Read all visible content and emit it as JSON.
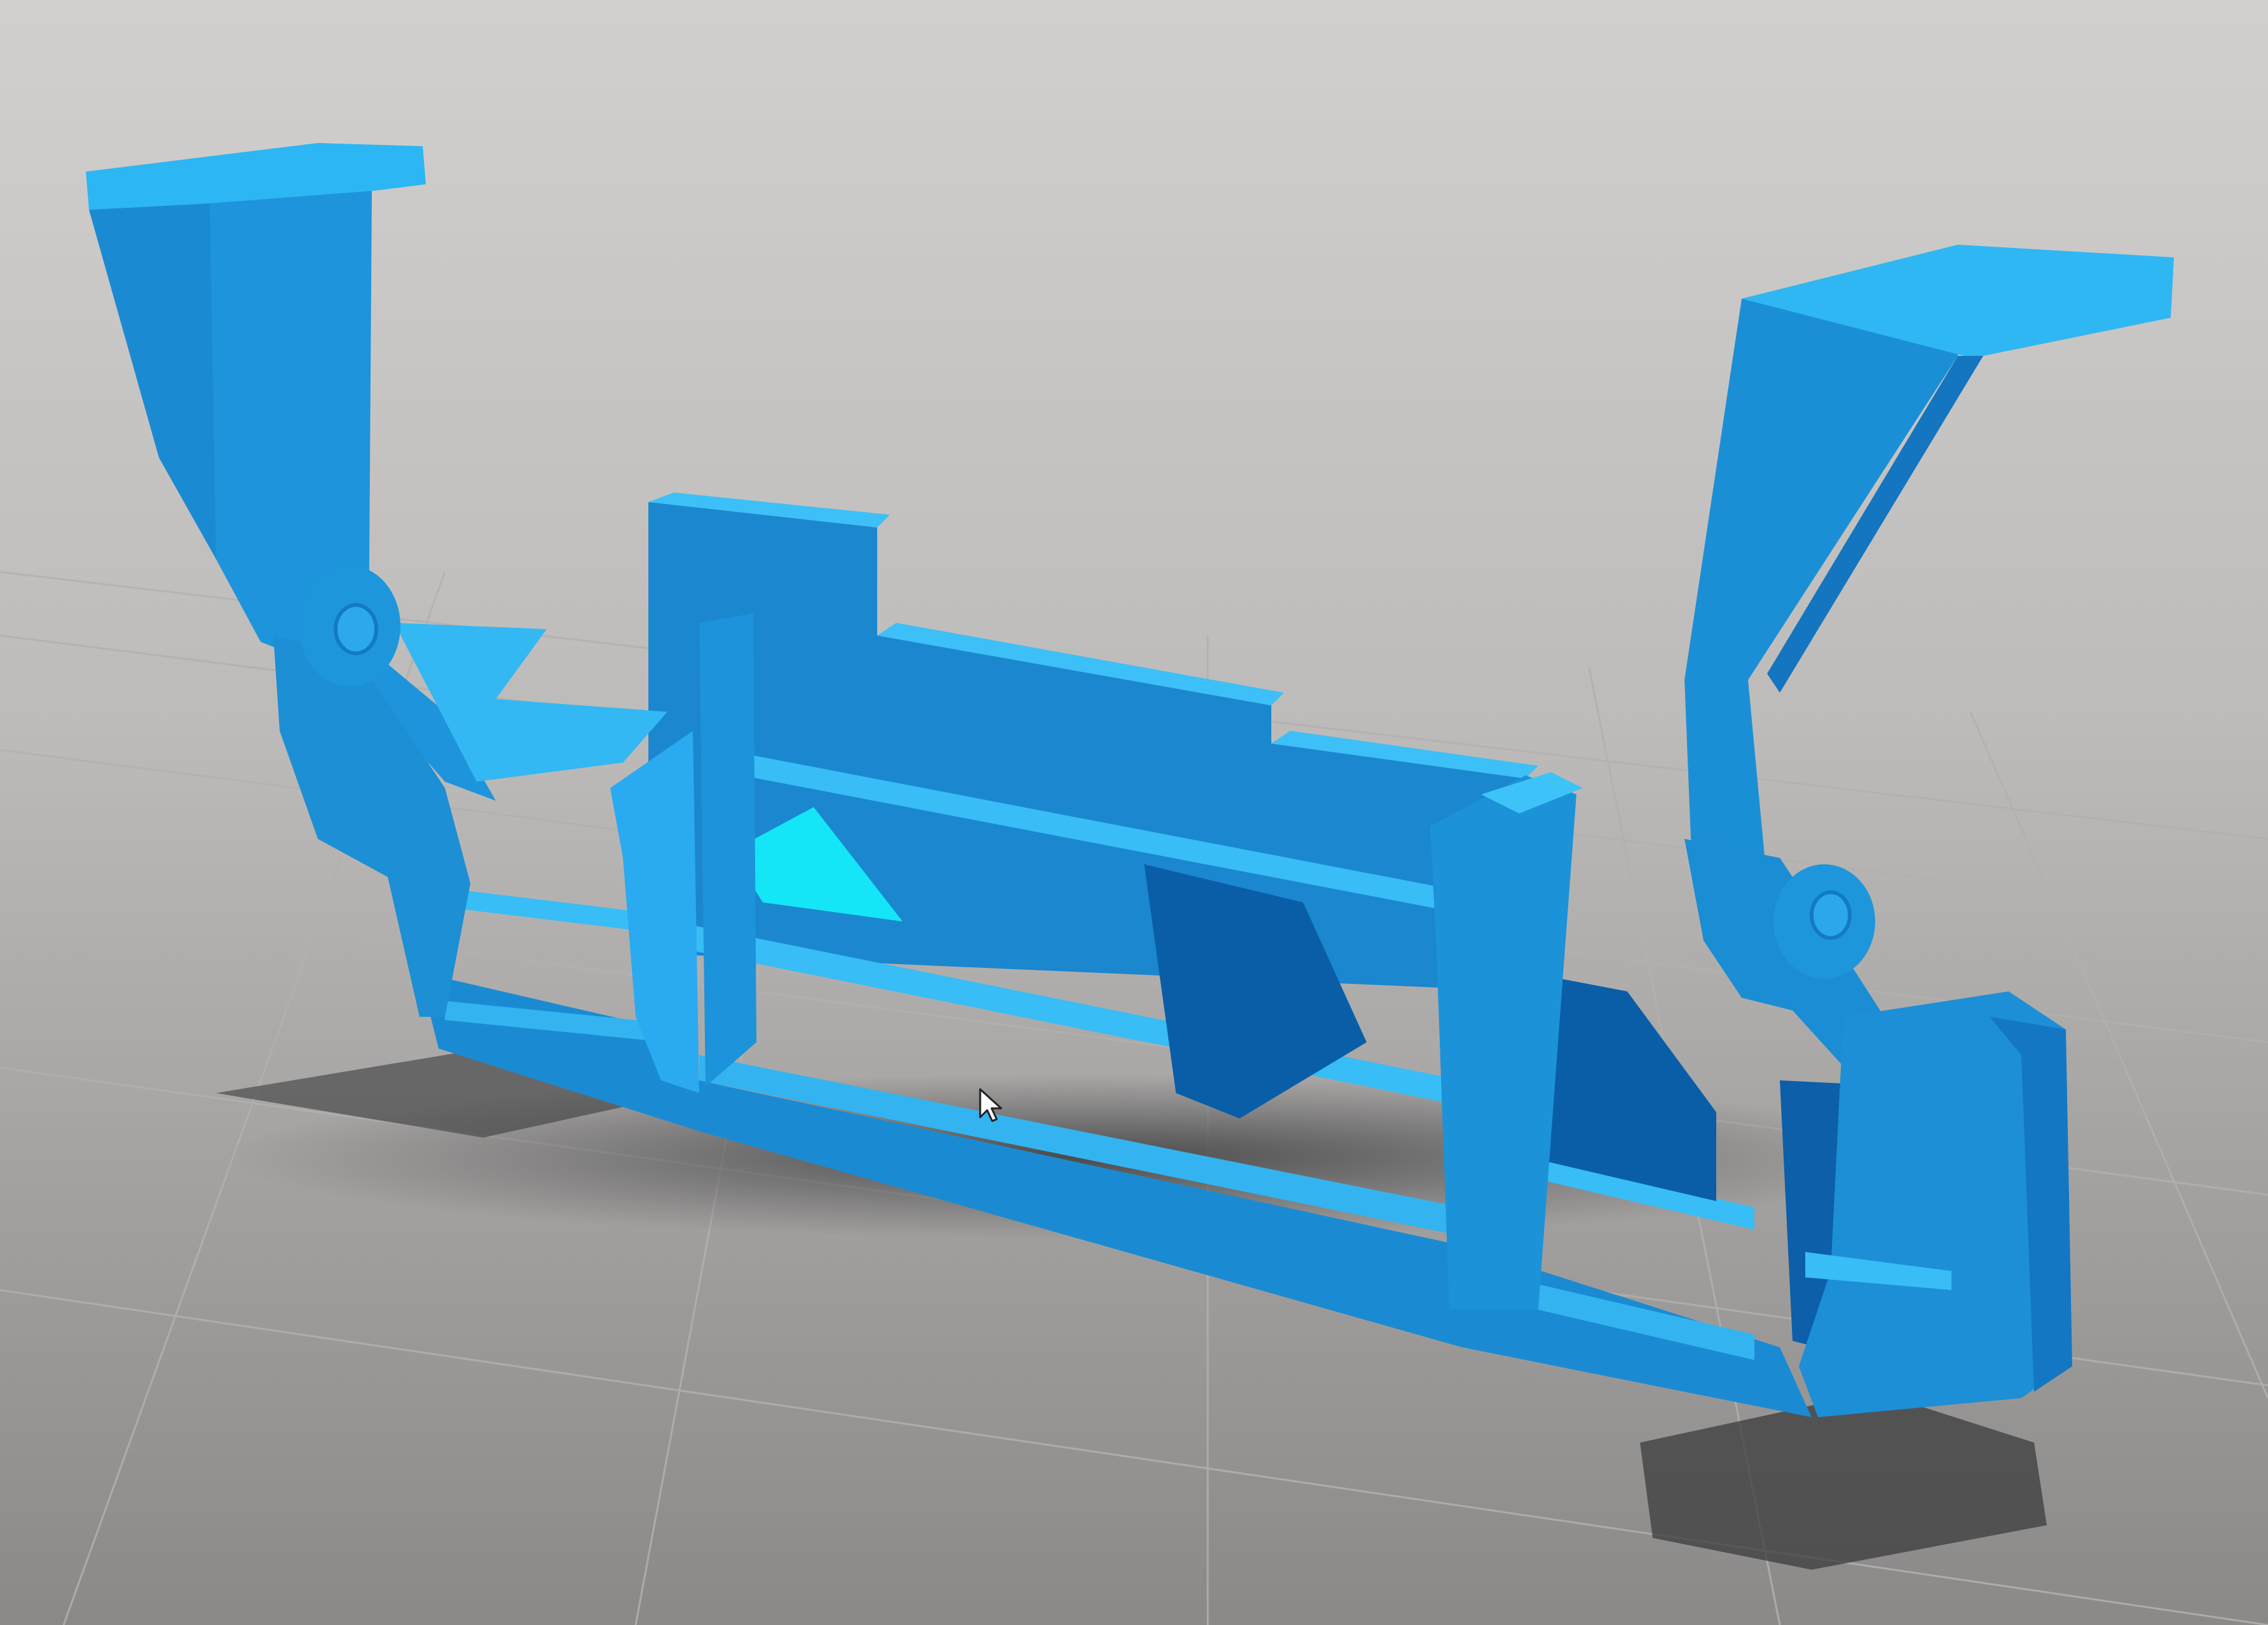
{
  "viewport": {
    "background_top": "#cfcdcb",
    "background_bottom": "#8e8c8b",
    "grid_line_color": "#b6b4b2"
  },
  "model": {
    "primary_color": "#1a8fd6",
    "highlight_color": "#2db8f5",
    "shadow_color": "#0c5fa8",
    "cyan_color": "#14e0f5"
  },
  "cursor": {
    "icon": "mouse-pointer-icon"
  }
}
